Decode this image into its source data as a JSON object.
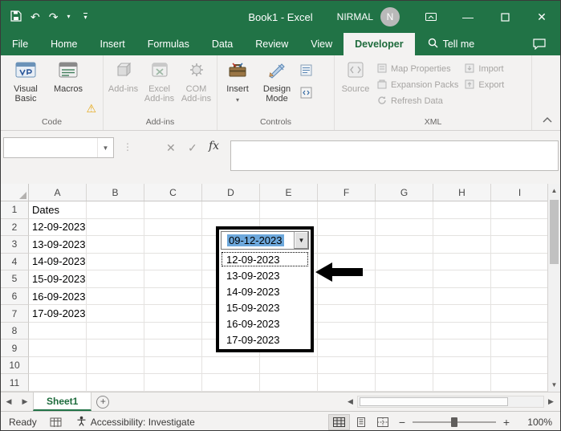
{
  "titlebar": {
    "title": "Book1 - Excel",
    "user_name": "NIRMAL",
    "avatar_initial": "N"
  },
  "menu": {
    "tabs": [
      "File",
      "Home",
      "Insert",
      "Formulas",
      "Data",
      "Review",
      "View",
      "Developer"
    ],
    "active_tab": "Developer",
    "tell_me": "Tell me"
  },
  "ribbon": {
    "code": {
      "label": "Code",
      "visual_basic": "Visual Basic",
      "macros": "Macros"
    },
    "addins": {
      "label": "Add-ins",
      "addins": "Add-ins",
      "excel_addins": "Excel Add-ins",
      "com_addins": "COM Add-ins"
    },
    "controls": {
      "label": "Controls",
      "insert": "Insert",
      "design_mode": "Design Mode"
    },
    "xml": {
      "label": "XML",
      "source": "Source",
      "map_properties": "Map Properties",
      "expansion_packs": "Expansion Packs",
      "refresh_data": "Refresh Data",
      "import": "Import",
      "export": "Export"
    }
  },
  "formula_bar": {
    "fx_label": "fx",
    "name_box_value": ""
  },
  "grid": {
    "col_headers": [
      "A",
      "B",
      "C",
      "D",
      "E",
      "F",
      "G",
      "H",
      "I"
    ],
    "rows": [
      {
        "n": "1",
        "a": "Dates"
      },
      {
        "n": "2",
        "a": "12-09-2023"
      },
      {
        "n": "3",
        "a": "13-09-2023"
      },
      {
        "n": "4",
        "a": "14-09-2023"
      },
      {
        "n": "5",
        "a": "15-09-2023"
      },
      {
        "n": "6",
        "a": "16-09-2023"
      },
      {
        "n": "7",
        "a": "17-09-2023"
      },
      {
        "n": "8",
        "a": ""
      },
      {
        "n": "9",
        "a": ""
      },
      {
        "n": "10",
        "a": ""
      },
      {
        "n": "11",
        "a": ""
      }
    ]
  },
  "combobox": {
    "value": "09-12-2023",
    "items": [
      "12-09-2023",
      "13-09-2023",
      "14-09-2023",
      "15-09-2023",
      "16-09-2023",
      "17-09-2023"
    ]
  },
  "sheet_bar": {
    "sheet_name": "Sheet1"
  },
  "status_bar": {
    "ready": "Ready",
    "accessibility": "Accessibility: Investigate",
    "zoom_out": "−",
    "zoom_in": "+",
    "zoom_level": "100%"
  },
  "colors": {
    "excel_green": "#217346",
    "combo_selection_blue": "#6da8dc",
    "annotation_black": "#000000"
  }
}
